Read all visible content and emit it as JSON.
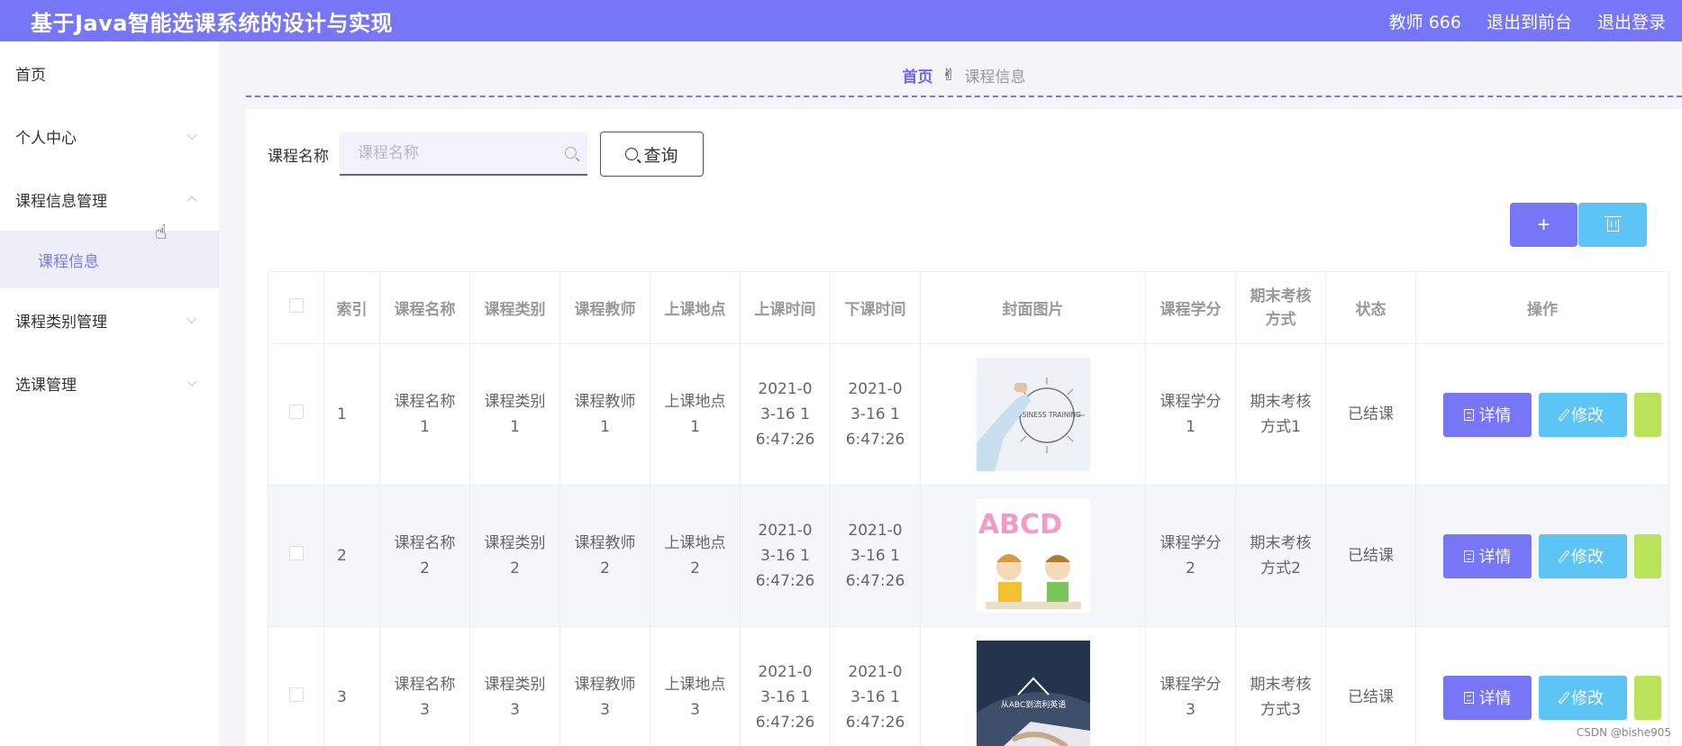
{
  "header": {
    "title": "基于Java智能选课系统的设计与实现",
    "user": "教师 666",
    "to_front": "退出到前台",
    "logout": "退出登录",
    "bg_color": "#7676f7"
  },
  "sidebar": {
    "items": [
      {
        "label": "首页"
      },
      {
        "label": "个人中心"
      },
      {
        "label": "课程信息管理"
      },
      {
        "label": "课程信息"
      },
      {
        "label": "课程类别管理"
      },
      {
        "label": "选课管理"
      }
    ]
  },
  "breadcrumb": {
    "home": "首页",
    "current": "课程信息"
  },
  "search": {
    "label": "课程名称",
    "placeholder": "课程名称",
    "button": "查询"
  },
  "toolbar": {
    "add": "+"
  },
  "table": {
    "headers": [
      "索引",
      "课程名称",
      "课程类别",
      "课程教师",
      "上课地点",
      "上课时间",
      "下课时间",
      "封面图片",
      "课程学分",
      "期末考核方式",
      "状态",
      "操作"
    ],
    "detail_label": "详情",
    "edit_label": "修改",
    "rows": [
      {
        "index": "1",
        "name": "课程名称1",
        "category": "课程类别1",
        "teacher": "课程教师1",
        "location": "上课地点1",
        "start": "2021-03-16 16:47:26",
        "end": "2021-03-16 16:47:26",
        "cover_text": "BUSINESS TRAINING",
        "credit": "课程学分1",
        "exam": "期末考核方式1",
        "status": "已结课"
      },
      {
        "index": "2",
        "name": "课程名称2",
        "category": "课程类别2",
        "teacher": "课程教师2",
        "location": "上课地点2",
        "start": "2021-03-16 16:47:26",
        "end": "2021-03-16 16:47:26",
        "cover_text": "ABCD",
        "credit": "课程学分2",
        "exam": "期末考核方式2",
        "status": "已结课"
      },
      {
        "index": "3",
        "name": "课程名称3",
        "category": "课程类别3",
        "teacher": "课程教师3",
        "location": "上课地点3",
        "start": "2021-03-16 16:47:26",
        "end": "2021-03-16 16:47:26",
        "cover_text": "从ABC到流利英语",
        "credit": "课程学分3",
        "exam": "期末考核方式3",
        "status": "已结课"
      }
    ]
  },
  "watermark": "CSDN @bishe905",
  "colors": {
    "primary": "#7676f7",
    "info": "#5cc5f5",
    "success": "#b9e35a"
  }
}
